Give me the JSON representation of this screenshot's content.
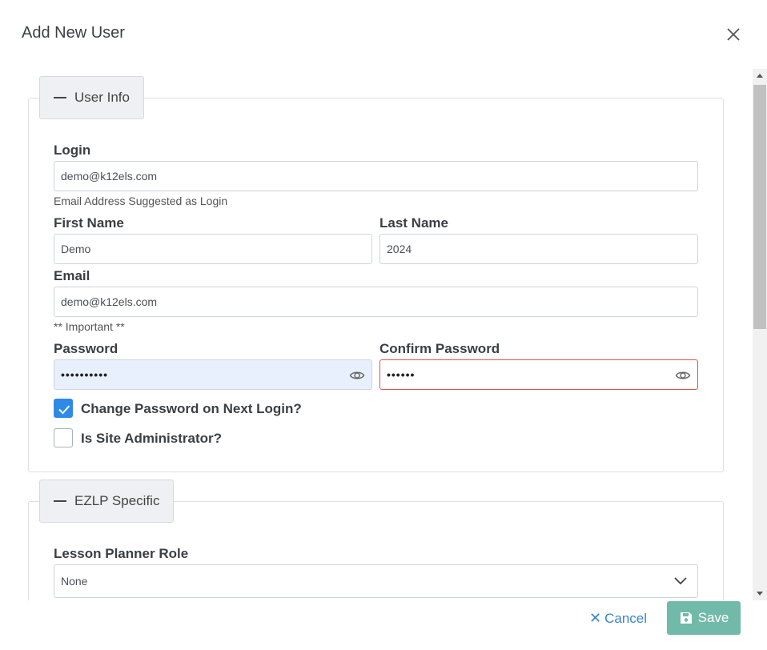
{
  "modal": {
    "title": "Add New User"
  },
  "user_info": {
    "section_label": "User Info",
    "login": {
      "label": "Login",
      "value": "demo@k12els.com",
      "hint": "Email Address Suggested as Login"
    },
    "first_name": {
      "label": "First Name",
      "value": "Demo"
    },
    "last_name": {
      "label": "Last Name",
      "value": "2024"
    },
    "email": {
      "label": "Email",
      "value": "demo@k12els.com",
      "hint": "** Important **"
    },
    "password": {
      "label": "Password",
      "value": "••••••••••"
    },
    "confirm_password": {
      "label": "Confirm Password",
      "value": "••••••"
    },
    "change_password": {
      "label": "Change Password on Next Login?",
      "checked": true
    },
    "site_admin": {
      "label": "Is Site Administrator?",
      "checked": false
    }
  },
  "ezlp": {
    "section_label": "EZLP Specific",
    "lesson_planner_role": {
      "label": "Lesson Planner Role",
      "value": "None"
    }
  },
  "footer": {
    "cancel_label": "Cancel",
    "save_label": "Save"
  },
  "colors": {
    "accent": "#2e8ae6",
    "save_button": "#71b9a8",
    "link": "#3a86c8",
    "error_border": "#d9534f"
  }
}
